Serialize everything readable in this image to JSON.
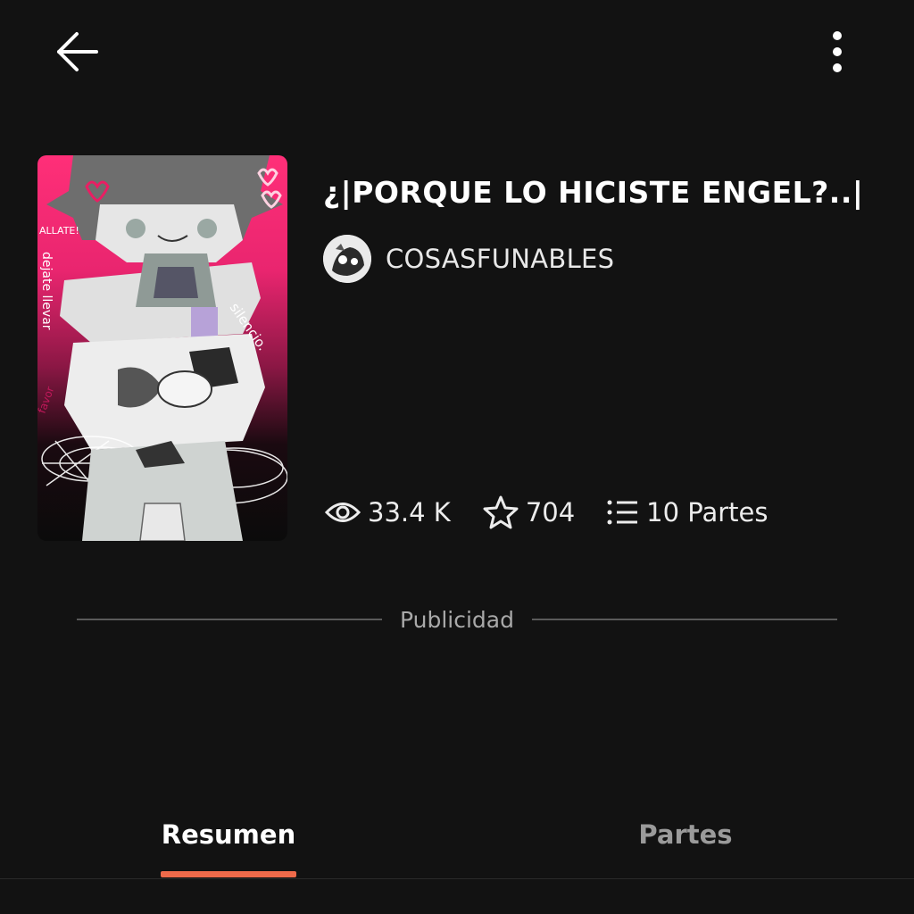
{
  "header": {
    "back_icon": "arrow-left-icon",
    "more_icon": "more-vertical-icon"
  },
  "story": {
    "title": "¿|PORQUE LO HICISTE ENGEL?..|",
    "author": "COSASFUNABLES",
    "cover_texts": [
      "ALLATE!",
      "dejate llevar",
      "silencio.",
      "favor"
    ],
    "stats": {
      "views": "33.4 K",
      "votes": "704",
      "parts": "10 Partes"
    }
  },
  "ad": {
    "label": "Publicidad"
  },
  "tabs": [
    {
      "label": "Resumen",
      "active": true
    },
    {
      "label": "Partes",
      "active": false
    }
  ],
  "colors": {
    "background": "#121212",
    "accent": "#ef6a4a",
    "cover_pink": "#ff2f78"
  }
}
